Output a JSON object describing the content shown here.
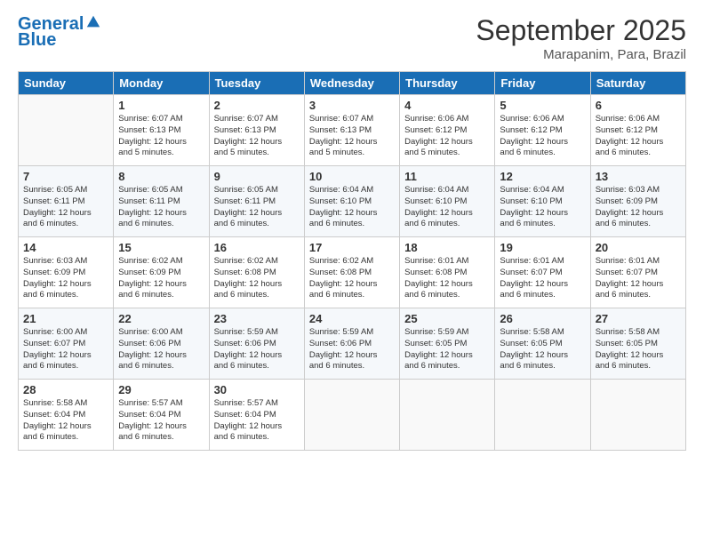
{
  "header": {
    "logo_line1": "General",
    "logo_line2": "Blue",
    "month": "September 2025",
    "location": "Marapanim, Para, Brazil"
  },
  "weekdays": [
    "Sunday",
    "Monday",
    "Tuesday",
    "Wednesday",
    "Thursday",
    "Friday",
    "Saturday"
  ],
  "weeks": [
    [
      {
        "day": "",
        "text": ""
      },
      {
        "day": "1",
        "text": "Sunrise: 6:07 AM\nSunset: 6:13 PM\nDaylight: 12 hours\nand 5 minutes."
      },
      {
        "day": "2",
        "text": "Sunrise: 6:07 AM\nSunset: 6:13 PM\nDaylight: 12 hours\nand 5 minutes."
      },
      {
        "day": "3",
        "text": "Sunrise: 6:07 AM\nSunset: 6:13 PM\nDaylight: 12 hours\nand 5 minutes."
      },
      {
        "day": "4",
        "text": "Sunrise: 6:06 AM\nSunset: 6:12 PM\nDaylight: 12 hours\nand 5 minutes."
      },
      {
        "day": "5",
        "text": "Sunrise: 6:06 AM\nSunset: 6:12 PM\nDaylight: 12 hours\nand 6 minutes."
      },
      {
        "day": "6",
        "text": "Sunrise: 6:06 AM\nSunset: 6:12 PM\nDaylight: 12 hours\nand 6 minutes."
      }
    ],
    [
      {
        "day": "7",
        "text": "Sunrise: 6:05 AM\nSunset: 6:11 PM\nDaylight: 12 hours\nand 6 minutes."
      },
      {
        "day": "8",
        "text": "Sunrise: 6:05 AM\nSunset: 6:11 PM\nDaylight: 12 hours\nand 6 minutes."
      },
      {
        "day": "9",
        "text": "Sunrise: 6:05 AM\nSunset: 6:11 PM\nDaylight: 12 hours\nand 6 minutes."
      },
      {
        "day": "10",
        "text": "Sunrise: 6:04 AM\nSunset: 6:10 PM\nDaylight: 12 hours\nand 6 minutes."
      },
      {
        "day": "11",
        "text": "Sunrise: 6:04 AM\nSunset: 6:10 PM\nDaylight: 12 hours\nand 6 minutes."
      },
      {
        "day": "12",
        "text": "Sunrise: 6:04 AM\nSunset: 6:10 PM\nDaylight: 12 hours\nand 6 minutes."
      },
      {
        "day": "13",
        "text": "Sunrise: 6:03 AM\nSunset: 6:09 PM\nDaylight: 12 hours\nand 6 minutes."
      }
    ],
    [
      {
        "day": "14",
        "text": "Sunrise: 6:03 AM\nSunset: 6:09 PM\nDaylight: 12 hours\nand 6 minutes."
      },
      {
        "day": "15",
        "text": "Sunrise: 6:02 AM\nSunset: 6:09 PM\nDaylight: 12 hours\nand 6 minutes."
      },
      {
        "day": "16",
        "text": "Sunrise: 6:02 AM\nSunset: 6:08 PM\nDaylight: 12 hours\nand 6 minutes."
      },
      {
        "day": "17",
        "text": "Sunrise: 6:02 AM\nSunset: 6:08 PM\nDaylight: 12 hours\nand 6 minutes."
      },
      {
        "day": "18",
        "text": "Sunrise: 6:01 AM\nSunset: 6:08 PM\nDaylight: 12 hours\nand 6 minutes."
      },
      {
        "day": "19",
        "text": "Sunrise: 6:01 AM\nSunset: 6:07 PM\nDaylight: 12 hours\nand 6 minutes."
      },
      {
        "day": "20",
        "text": "Sunrise: 6:01 AM\nSunset: 6:07 PM\nDaylight: 12 hours\nand 6 minutes."
      }
    ],
    [
      {
        "day": "21",
        "text": "Sunrise: 6:00 AM\nSunset: 6:07 PM\nDaylight: 12 hours\nand 6 minutes."
      },
      {
        "day": "22",
        "text": "Sunrise: 6:00 AM\nSunset: 6:06 PM\nDaylight: 12 hours\nand 6 minutes."
      },
      {
        "day": "23",
        "text": "Sunrise: 5:59 AM\nSunset: 6:06 PM\nDaylight: 12 hours\nand 6 minutes."
      },
      {
        "day": "24",
        "text": "Sunrise: 5:59 AM\nSunset: 6:06 PM\nDaylight: 12 hours\nand 6 minutes."
      },
      {
        "day": "25",
        "text": "Sunrise: 5:59 AM\nSunset: 6:05 PM\nDaylight: 12 hours\nand 6 minutes."
      },
      {
        "day": "26",
        "text": "Sunrise: 5:58 AM\nSunset: 6:05 PM\nDaylight: 12 hours\nand 6 minutes."
      },
      {
        "day": "27",
        "text": "Sunrise: 5:58 AM\nSunset: 6:05 PM\nDaylight: 12 hours\nand 6 minutes."
      }
    ],
    [
      {
        "day": "28",
        "text": "Sunrise: 5:58 AM\nSunset: 6:04 PM\nDaylight: 12 hours\nand 6 minutes."
      },
      {
        "day": "29",
        "text": "Sunrise: 5:57 AM\nSunset: 6:04 PM\nDaylight: 12 hours\nand 6 minutes."
      },
      {
        "day": "30",
        "text": "Sunrise: 5:57 AM\nSunset: 6:04 PM\nDaylight: 12 hours\nand 6 minutes."
      },
      {
        "day": "",
        "text": ""
      },
      {
        "day": "",
        "text": ""
      },
      {
        "day": "",
        "text": ""
      },
      {
        "day": "",
        "text": ""
      }
    ]
  ]
}
